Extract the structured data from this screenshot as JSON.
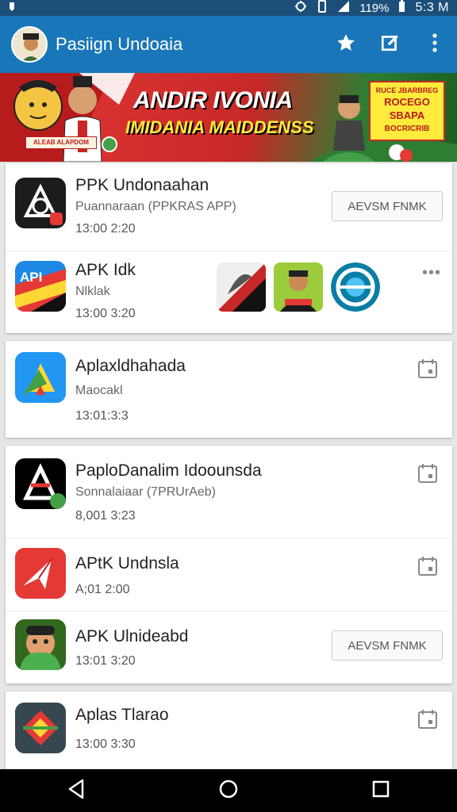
{
  "status_bar": {
    "time": "5:3 M",
    "battery": "119%"
  },
  "app_bar": {
    "title": "Pasiign Undoaia"
  },
  "banner": {
    "headline": "ANDIR IVONIA",
    "subline": "IMIDANIA MAIDDENSS",
    "tag": "ALEAB ALAPDOM",
    "promo_line1": "RUCE JBARBREG",
    "promo_line2": "ROCEGO",
    "promo_line3": "SBAPA",
    "promo_line4": "BOCRICRIB"
  },
  "cards": [
    {
      "rows": [
        {
          "name": "PPK Undonaahan",
          "subtitle": "Puannaraan (PPKRAS APP)",
          "date": "13:00 2:20",
          "button": "AEVSM FNMK"
        },
        {
          "name": "APK Idk",
          "subtitle": "Nlklak",
          "date": "13:00 3:20",
          "more": "•••"
        }
      ]
    },
    {
      "rows": [
        {
          "name": "Aplaxldhahada",
          "subtitle": "Maocakl",
          "date": "13:01:3:3"
        }
      ]
    },
    {
      "rows": [
        {
          "name": "PaploDanalim Idoounsda",
          "subtitle": "Sonnalaiaar (7PRUrAeb)",
          "date": "8,001 3:23"
        },
        {
          "name": "APtK Undnsla",
          "subtitle": "",
          "date": "A;01 2:00"
        },
        {
          "name": "APK Ulnideabd",
          "subtitle": "",
          "date": "13:01 3:20",
          "button": "AEVSM FNMK"
        }
      ]
    },
    {
      "rows": [
        {
          "name": "Aplas Tlarao",
          "subtitle": "",
          "date": "13:00 3:30"
        }
      ]
    }
  ],
  "colors": {
    "app_bar": "#1976b8",
    "status_bar": "#1b4f7a",
    "banner_red": "#c62828",
    "accent_green": "#2e7d32"
  },
  "icons": [
    "wifi-icon",
    "signal-icon",
    "star-icon",
    "edit-icon",
    "more-vert-icon",
    "calendar-icon",
    "back-icon",
    "home-icon",
    "recents-icon"
  ]
}
